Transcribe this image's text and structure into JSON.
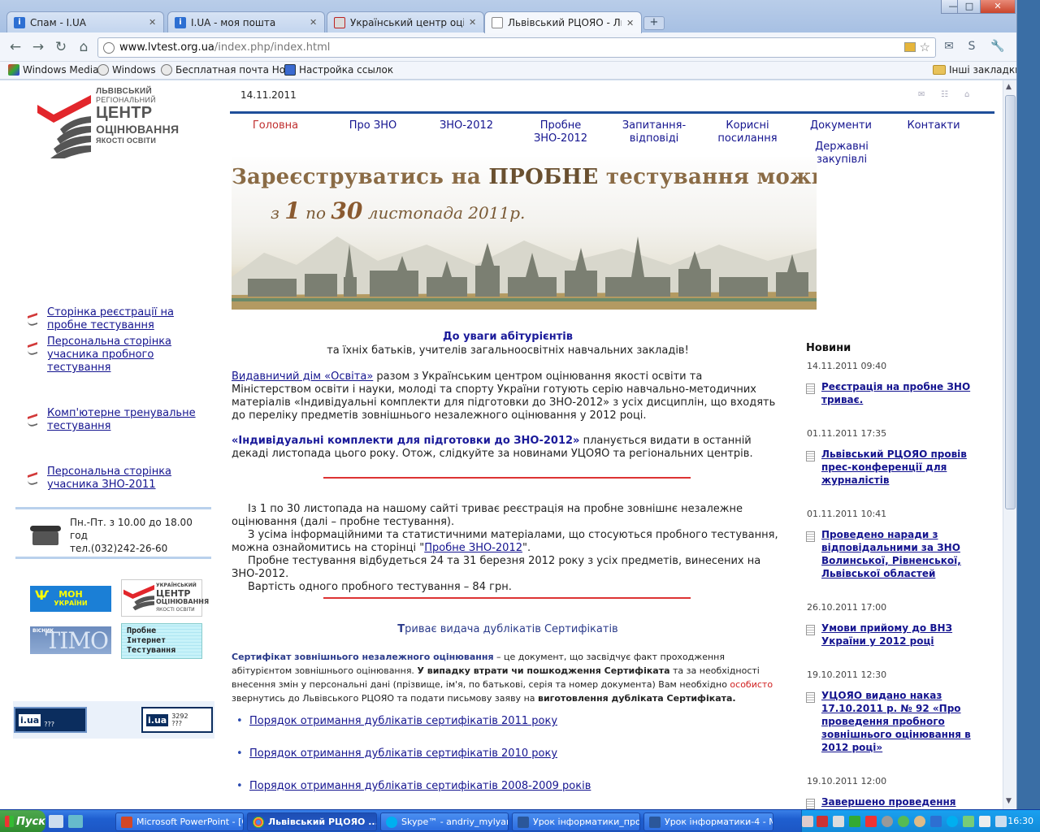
{
  "browser": {
    "tabs": [
      {
        "title": "Спам - I.UA"
      },
      {
        "title": "I.UA - моя пошта"
      },
      {
        "title": "Український центр оцінюван"
      },
      {
        "title": "Львівський РЦОЯО - Львівсі"
      }
    ],
    "url_host": "www.lvtest.org.ua",
    "url_path": "/index.php/index.html",
    "bookmarks": [
      "Windows Media",
      "Windows",
      "Бесплатная почта Но...",
      "Настройка ссылок"
    ],
    "other_bookmarks": "Інші закладки"
  },
  "site": {
    "logo": {
      "line1": "ЛЬВІВСЬКИЙ",
      "line2": "РЕГІОНАЛЬНИЙ",
      "line3": "ЦЕНТР",
      "line4": "ОЦІНЮВАННЯ",
      "line5": "ЯКОСТІ ОСВІТИ"
    },
    "date": "14.11.2011",
    "nav": [
      "Головна",
      "Про ЗНО",
      "ЗНО-2012",
      "Пробне ЗНО-2012",
      "Запитання-відповіді",
      "Корисні посилання",
      "Документи",
      "Контакти",
      "Державні закупівлі"
    ],
    "hero": {
      "line1a": "Зареєструватись на ",
      "line1b": "ПРОБНЕ",
      "line1c": " тестування можна",
      "line2a": "з ",
      "line2b": "1",
      "line2c": " по ",
      "line2d": "30",
      "line2e": " листопада 2011р."
    },
    "left_menu": [
      "Сторінка реєстрації на пробне тестування",
      "Персональна сторінка учасника пробного тестування",
      "Комп'ютерне тренувальне тестування",
      "Персональна сторінка учасника ЗНО-2011"
    ],
    "contact": {
      "hours": "Пн.-Пт. з 10.00 до 18.00 год",
      "phone": "тел.(032)242-26-60"
    },
    "banners": {
      "mon": "МОН",
      "mon_sub": "УКРАЇНИ",
      "ucoyo1": "УКРАЇНСЬКИЙ",
      "ucoyo2": "ЦЕНТР",
      "ucoyo3": "ОЦІНЮВАННЯ",
      "ucoyo4": "ЯКОСТІ ОСВІТИ",
      "visnyk": "ВІСНИК",
      "timo": "ТІМО",
      "probne1": "Пробне",
      "probne2": "Інтернет",
      "probne3": "Тестування",
      "iua_counter1": "???",
      "iua_counter2_top": "3292",
      "iua_counter2_bottom": "???",
      "iua_logo": "i.ua"
    },
    "main": {
      "heading": "До уваги абітурієнтів",
      "subheading": "та їхніх батьків, учителів загальноосвітніх навчальних закладів!",
      "p1_link": "Видавничий дім «Освіта»",
      "p1_text": " разом з Українським центром оцінювання якості освіти та Міністерством освіти і науки, молоді та спорту України готують серію навчально-методичних матеріалів «Індивідуальні комплекти для підготовки до ЗНО-2012» з усіх дисциплін, що входять до переліку предметів зовнішнього незалежного оцінювання у 2012 році.",
      "p2_bold": "«Індивідуальні комплекти для підготовки до ЗНО-2012»",
      "p2_text": " планується видати в останній декаді листопада цього року.  Отож, слідкуйте за новинами УЦОЯО та регіональних центрів.",
      "p3": "Із 1 по 30 листопада на нашому сайті триває реєстрація на пробне зовнішнє незалежне оцінювання (далі – пробне тестування).",
      "p4a": "З усіма інформаційними та статистичними матеріалами, що стосуються пробного тестування, можна ознайомитись на сторінці \"",
      "p4_link": "Пробне ЗНО-2012",
      "p4b": "\".",
      "p5": "Пробне тестування відбудеться 24 та 31 березня 2012 року з усіх предметів, винесених на ЗНО-2012.",
      "p6": "Вартість одного пробного тестування – 84 грн.",
      "dup_title_t": "Т",
      "dup_title": "риває видача дублікатів Сертифікатів",
      "cert_bold": "Сертифікат зовнішнього незалежного оцінювання",
      "cert_t1": " – це документ, що засвідчує факт проходження абітурієнтом зовнішнього оцінювання. ",
      "cert_b2": "У випадку втрати чи пошкодження Сертифіката",
      "cert_t2": "  та за необхідності внесення змін у персональні дані (прізвище, ім'я, по батькові, серія та номер документа) Вам необхідно ",
      "cert_red": "особисто",
      "cert_t3": " звернутись до Львівського РЦОЯО та подати письмову заяву на ",
      "cert_b3": "виготовлення дубліката Сертифіката.",
      "docs": [
        "Порядок отримання дублікатів сертифікатів 2011 року",
        "Порядок отримання дублікатів сертифікатів 2010 року",
        "Порядок отримання дублікатів сертифікатів 2008-2009 років"
      ]
    },
    "news": {
      "title": "Новини",
      "items": [
        {
          "date": "14.11.2011 09:40",
          "title": "Реєстрація на пробне ЗНО триває."
        },
        {
          "date": "01.11.2011 17:35",
          "title": "Львівський РЦОЯО провів прес-конференції для журналістів"
        },
        {
          "date": "01.11.2011 10:41",
          "title": "Проведено наради з відповідальними за ЗНО Волинської, Рівненської, Львівської областей"
        },
        {
          "date": "26.10.2011 17:00",
          "title": "Умови прийому до ВНЗ України у 2012 році"
        },
        {
          "date": "19.10.2011 12:30",
          "title": "УЦОЯО видано наказ 17.10.2011 р. № 92 «Про проведення пробного зовнішнього оцінювання в 2012 році»"
        },
        {
          "date": "19.10.2011 12:00",
          "title": "Завершено проведення"
        }
      ]
    }
  },
  "taskbar": {
    "start": "Пуск",
    "items": [
      "Microsoft PowerPoint - [О...",
      "Львівський РЦОЯО ...",
      "Skype™ - andriy_mylyanyk",
      "Урок інформатики_про...",
      "Урок інформатики-4 - Mi..."
    ],
    "clock": "16:30"
  }
}
